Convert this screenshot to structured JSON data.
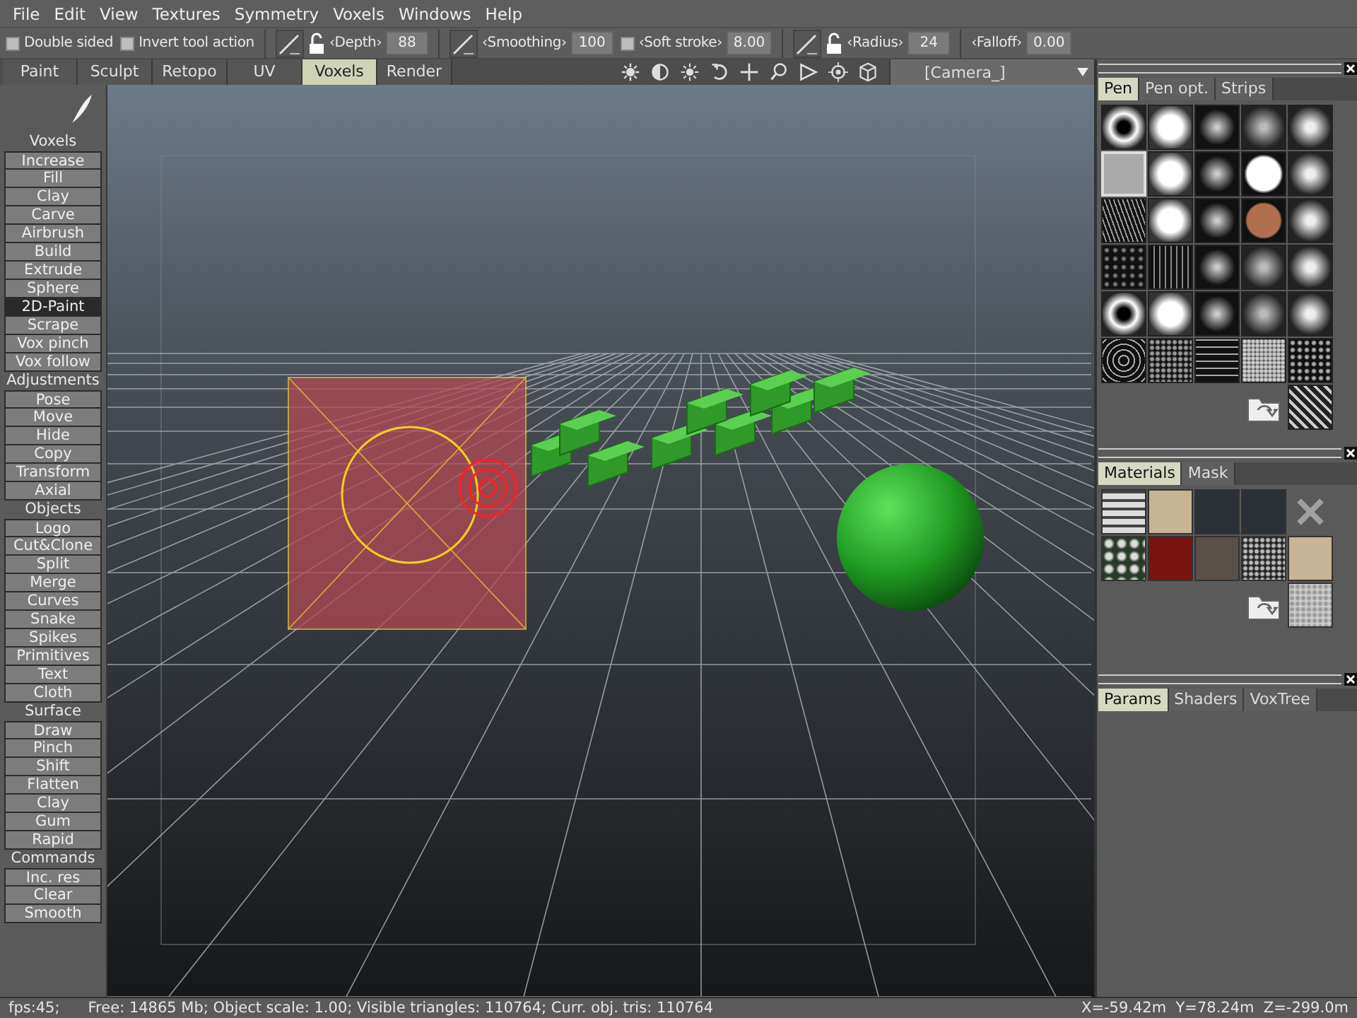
{
  "menu": [
    "File",
    "Edit",
    "View",
    "Textures",
    "Symmetry",
    "Voxels",
    "Windows",
    "Help"
  ],
  "toolbar": [
    {
      "kind": "checkbox",
      "label": "Double sided",
      "checked": false
    },
    {
      "kind": "checkbox",
      "label": "Invert tool action",
      "checked": false
    },
    {
      "kind": "field",
      "pen": true,
      "locked": false,
      "label": "‹Depth›",
      "value": "88"
    },
    {
      "kind": "field",
      "pen": true,
      "label": "‹Smoothing›",
      "value": "100"
    },
    {
      "kind": "checkfield",
      "label": "‹Soft stroke›",
      "value": "8.00",
      "checked": false
    },
    {
      "kind": "field",
      "pen": true,
      "locked": false,
      "label": "‹Radius›",
      "value": "24"
    },
    {
      "kind": "field",
      "pen": false,
      "label": "‹Falloff›",
      "value": "0.00"
    }
  ],
  "rooms": [
    {
      "label": "Paint",
      "selected": false
    },
    {
      "label": "Sculpt",
      "selected": false
    },
    {
      "label": "Retopo",
      "selected": false
    },
    {
      "label": "UV",
      "selected": false
    },
    {
      "label": "Voxels",
      "selected": true
    },
    {
      "label": "Render",
      "selected": false
    }
  ],
  "camera": "[Camera_]",
  "tools": [
    {
      "kind": "header",
      "label": "Voxels"
    },
    {
      "kind": "button",
      "label": "Increase",
      "selected": false
    },
    {
      "kind": "button",
      "label": "Fill",
      "selected": false
    },
    {
      "kind": "button",
      "label": "Clay",
      "selected": false
    },
    {
      "kind": "button",
      "label": "Carve",
      "selected": false
    },
    {
      "kind": "button",
      "label": "Airbrush",
      "selected": false
    },
    {
      "kind": "button",
      "label": "Build",
      "selected": false
    },
    {
      "kind": "button",
      "label": "Extrude",
      "selected": false
    },
    {
      "kind": "button",
      "label": "Sphere",
      "selected": false
    },
    {
      "kind": "button",
      "label": "2D-Paint",
      "selected": true
    },
    {
      "kind": "button",
      "label": "Scrape",
      "selected": false
    },
    {
      "kind": "button",
      "label": "Vox pinch",
      "selected": false
    },
    {
      "kind": "button",
      "label": "Vox follow",
      "selected": false
    },
    {
      "kind": "header",
      "label": "Adjustments"
    },
    {
      "kind": "button",
      "label": "Pose",
      "selected": false
    },
    {
      "kind": "button",
      "label": "Move",
      "selected": false
    },
    {
      "kind": "button",
      "label": "Hide",
      "selected": false
    },
    {
      "kind": "button",
      "label": "Copy",
      "selected": false
    },
    {
      "kind": "button",
      "label": "Transform",
      "selected": false
    },
    {
      "kind": "button",
      "label": "Axial",
      "selected": false
    },
    {
      "kind": "header",
      "label": "Objects"
    },
    {
      "kind": "button",
      "label": "Logo",
      "selected": false
    },
    {
      "kind": "button",
      "label": "Cut&Clone",
      "selected": false
    },
    {
      "kind": "button",
      "label": "Split",
      "selected": false
    },
    {
      "kind": "button",
      "label": "Merge",
      "selected": false
    },
    {
      "kind": "button",
      "label": "Curves",
      "selected": false
    },
    {
      "kind": "button",
      "label": "Snake",
      "selected": false
    },
    {
      "kind": "button",
      "label": "Spikes",
      "selected": false
    },
    {
      "kind": "button",
      "label": "Primitives",
      "selected": false
    },
    {
      "kind": "button",
      "label": "Text",
      "selected": false
    },
    {
      "kind": "button",
      "label": "Cloth",
      "selected": false
    },
    {
      "kind": "header",
      "label": "Surface"
    },
    {
      "kind": "button",
      "label": "Draw",
      "selected": false
    },
    {
      "kind": "button",
      "label": "Pinch",
      "selected": false
    },
    {
      "kind": "button",
      "label": "Shift",
      "selected": false
    },
    {
      "kind": "button",
      "label": "Flatten",
      "selected": false
    },
    {
      "kind": "button",
      "label": "Clay",
      "selected": false
    },
    {
      "kind": "button",
      "label": "Gum",
      "selected": false
    },
    {
      "kind": "button",
      "label": "Rapid",
      "selected": false
    },
    {
      "kind": "header",
      "label": "Commands"
    },
    {
      "kind": "button",
      "label": "Inc. res",
      "selected": false
    },
    {
      "kind": "button",
      "label": "Clear",
      "selected": false
    },
    {
      "kind": "button",
      "label": "Smooth",
      "selected": false
    }
  ],
  "pen_panel": {
    "tabs": [
      {
        "label": "Pen",
        "selected": true
      },
      {
        "label": "Pen opt.",
        "selected": false
      },
      {
        "label": "Strips",
        "selected": false
      }
    ],
    "brushes": [
      {
        "selected": false
      },
      {
        "selected": false
      },
      {
        "selected": false
      },
      {
        "selected": false
      },
      {
        "selected": false
      },
      {
        "selected": true
      },
      {
        "selected": false
      },
      {
        "selected": false
      },
      {
        "selected": false
      },
      {
        "selected": false
      },
      {
        "selected": false
      },
      {
        "selected": false
      },
      {
        "selected": false
      },
      {
        "selected": false
      },
      {
        "selected": false
      },
      {
        "selected": false
      },
      {
        "selected": false
      },
      {
        "selected": false
      },
      {
        "selected": false
      },
      {
        "selected": false
      },
      {
        "selected": false
      },
      {
        "selected": false
      },
      {
        "selected": false
      },
      {
        "selected": false
      },
      {
        "selected": false
      },
      {
        "selected": false
      },
      {
        "selected": false
      },
      {
        "selected": false
      },
      {
        "selected": false
      },
      {
        "selected": false
      },
      {
        "selected": false
      }
    ]
  },
  "materials_panel": {
    "tabs": [
      {
        "label": "Materials",
        "selected": true
      },
      {
        "label": "Mask",
        "selected": false
      }
    ]
  },
  "params_panel": {
    "tabs": [
      {
        "label": "Params",
        "selected": true
      },
      {
        "label": "Shaders",
        "selected": false
      },
      {
        "label": "VoxTree",
        "selected": false
      }
    ]
  },
  "status_bar": {
    "fps": "fps:45;",
    "info": "Free: 14865 Mb; Object scale: 1.00; Visible triangles: 110764; Curr. obj. tris: 110764",
    "coords": "X=-59.42m  Y=78.24m  Z=-299.0m"
  }
}
